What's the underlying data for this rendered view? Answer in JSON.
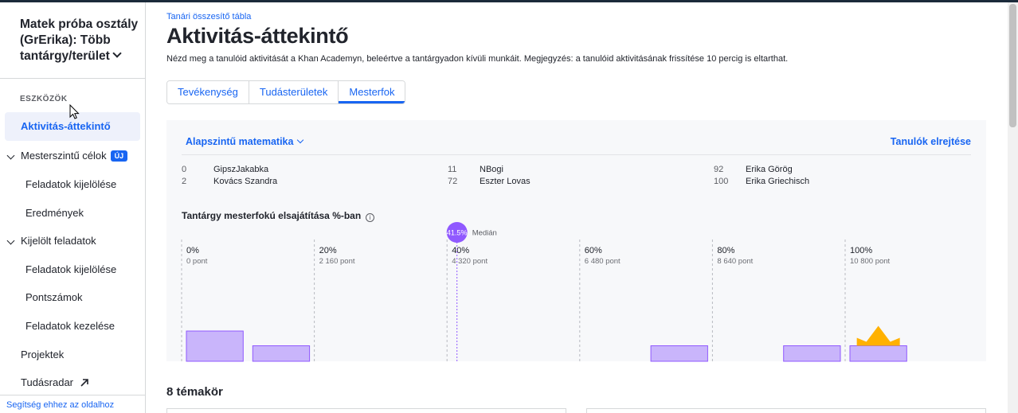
{
  "sidebar": {
    "class_title": "Matek próba osztály (GrErika): Több tantárgy/terület",
    "tools_label": "ESZKÖZÖK",
    "items": [
      {
        "label": "Aktivitás-áttekintő"
      },
      {
        "label": "Mesterszintű célok",
        "badge": "ÚJ"
      },
      {
        "label": "Feladatok kijelölése"
      },
      {
        "label": "Eredmények"
      },
      {
        "label": "Kijelölt feladatok"
      },
      {
        "label": "Feladatok kijelölése"
      },
      {
        "label": "Pontszámok"
      },
      {
        "label": "Feladatok kezelése"
      },
      {
        "label": "Projektek"
      },
      {
        "label": "Tudásradar"
      }
    ],
    "help_link": "Segítség ehhez az oldalhoz"
  },
  "header": {
    "breadcrumb": "Tanári összesítő tábla",
    "title": "Aktivitás-áttekintő",
    "description": "Nézd meg a tanulóid aktivitását a Khan Academyn, beleértve a tantárgyadon kívüli munkáit. Megjegyzés: a tanulóid aktivitásának frissítése 10 percig is eltarthat."
  },
  "tabs": [
    {
      "label": "Tevékenység",
      "selected": false
    },
    {
      "label": "Tudásterületek",
      "selected": false
    },
    {
      "label": "Mesterfok",
      "selected": true
    }
  ],
  "panel": {
    "subject": "Alapszintű matematika",
    "hide_students": "Tanulók elrejtése",
    "students": [
      {
        "num": "0",
        "name": "GipszJakabka"
      },
      {
        "num": "2",
        "name": "Kovács Szandra"
      },
      {
        "num": "11",
        "name": "NBogi"
      },
      {
        "num": "72",
        "name": "Eszter Lovas"
      },
      {
        "num": "92",
        "name": "Erika Görög"
      },
      {
        "num": "100",
        "name": "Erika Griechisch"
      }
    ],
    "mastery_title": "Tantárgy mesterfokú elsajátítása %-ban",
    "info_icon": "i"
  },
  "chart_data": {
    "type": "bar",
    "title": "Tantárgy mesterfokú elsajátítása %-ban",
    "xlim": [
      0,
      100
    ],
    "ticks": [
      {
        "pct": 0,
        "label": "0%",
        "points": "0 pont"
      },
      {
        "pct": 20,
        "label": "20%",
        "points": "2 160 pont"
      },
      {
        "pct": 40,
        "label": "40%",
        "points": "4 320 pont"
      },
      {
        "pct": 60,
        "label": "60%",
        "points": "6 480 pont"
      },
      {
        "pct": 80,
        "label": "80%",
        "points": "8 640 pont"
      },
      {
        "pct": 100,
        "label": "100%",
        "points": "10 800 pont"
      }
    ],
    "bins": [
      {
        "start": 0,
        "end": 10,
        "count": 2
      },
      {
        "start": 10,
        "end": 20,
        "count": 1
      },
      {
        "start": 70,
        "end": 80,
        "count": 1
      },
      {
        "start": 90,
        "end": 100,
        "count": 1
      },
      {
        "start": 100,
        "end": 110,
        "count": 1,
        "crown": true
      }
    ],
    "median": {
      "value": 41.5,
      "label": "41.5%",
      "text": "Medián"
    },
    "bar_color": "#c9b5fb",
    "bar_stroke": "#9059ff",
    "median_color": "#9059ff",
    "crown_color": "#ffb100"
  },
  "topics": {
    "title": "8 témakör"
  }
}
